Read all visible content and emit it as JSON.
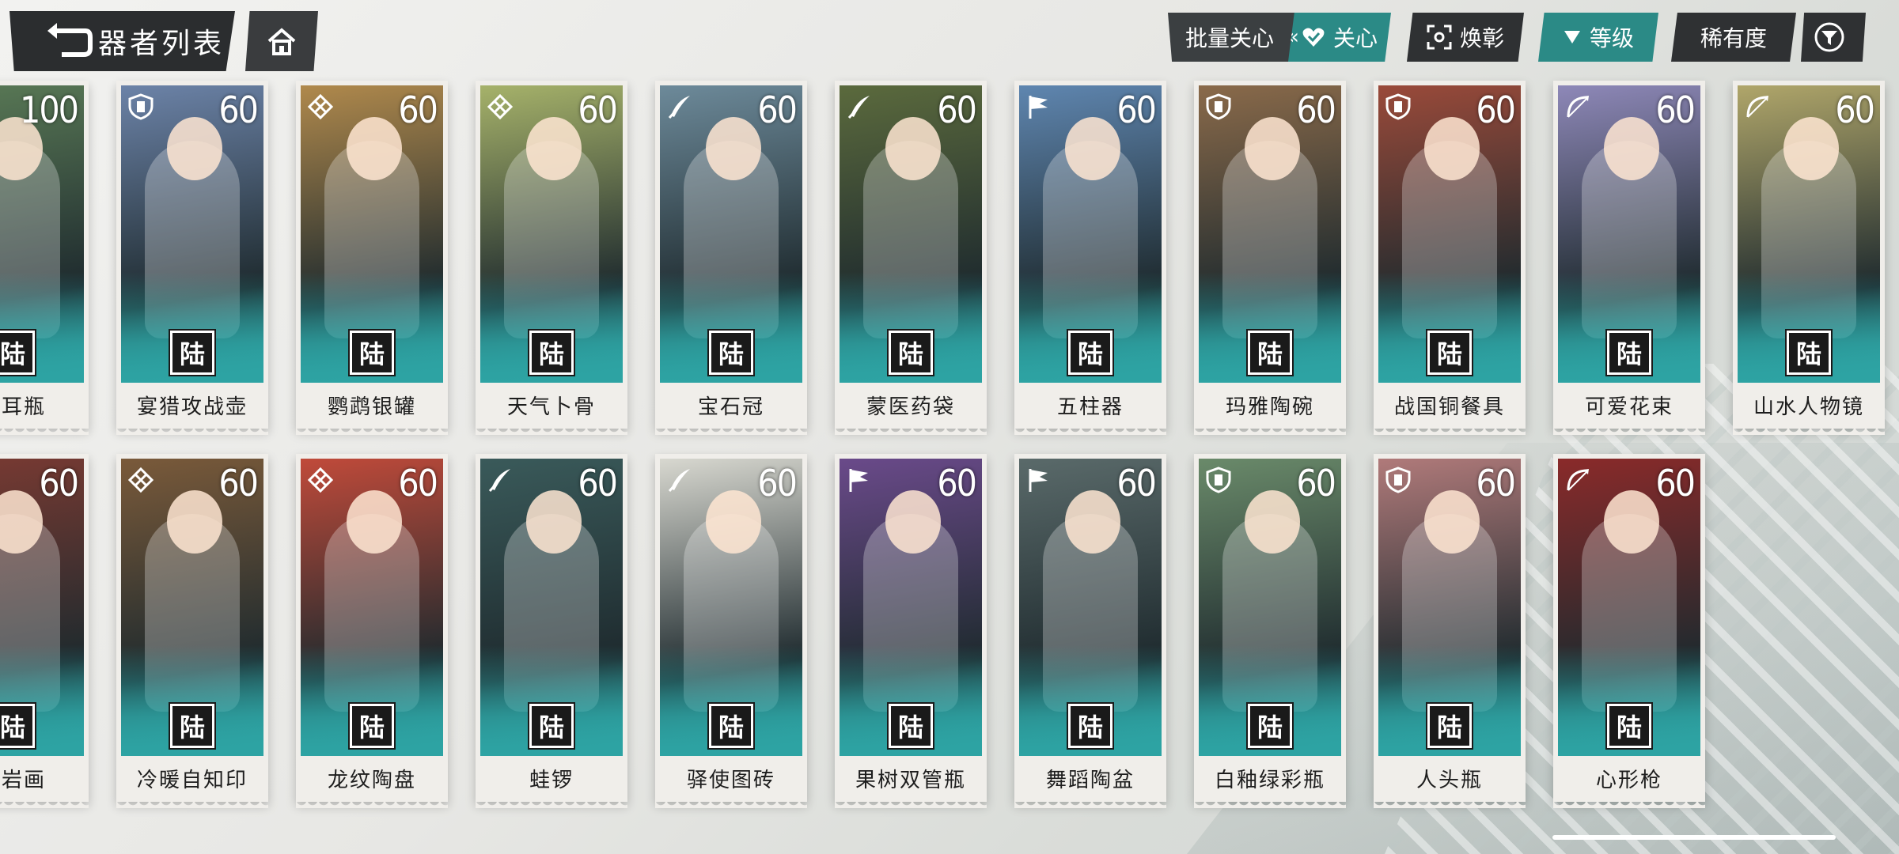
{
  "header": {
    "back_label": "器者列表",
    "batch_care": "批量关心",
    "care": "关心",
    "huanzhang": "焕彰",
    "level": "等级",
    "rarity": "稀有度"
  },
  "colors": {
    "teal": "#2b8a86",
    "dark": "#2f3133",
    "card_bg": "#f0eeea"
  },
  "cards": [
    {
      "name": "双耳瓶",
      "level": "100",
      "stamp": "陆",
      "class_icon": "bow-icon",
      "tint": "#5a7a56"
    },
    {
      "name": "宴猎攻战壶",
      "level": "60",
      "stamp": "陆",
      "class_icon": "shield-icon",
      "tint": "#6c83a8"
    },
    {
      "name": "鹦鹉银罐",
      "level": "60",
      "stamp": "陆",
      "class_icon": "knot-icon",
      "tint": "#b0894c"
    },
    {
      "name": "天气卜骨",
      "level": "60",
      "stamp": "陆",
      "class_icon": "knot-icon",
      "tint": "#a6b26a"
    },
    {
      "name": "宝石冠",
      "level": "60",
      "stamp": "陆",
      "class_icon": "quill-icon",
      "tint": "#6d8a9a"
    },
    {
      "name": "蒙医药袋",
      "level": "60",
      "stamp": "陆",
      "class_icon": "quill-icon",
      "tint": "#5b6a3d"
    },
    {
      "name": "五柱器",
      "level": "60",
      "stamp": "陆",
      "class_icon": "flag-icon",
      "tint": "#5f86b0"
    },
    {
      "name": "玛雅陶碗",
      "level": "60",
      "stamp": "陆",
      "class_icon": "shield-icon",
      "tint": "#8a6a4a"
    },
    {
      "name": "战国铜餐具",
      "level": "60",
      "stamp": "陆",
      "class_icon": "shield-icon",
      "tint": "#9a4a3a"
    },
    {
      "name": "可爱花束",
      "level": "60",
      "stamp": "陆",
      "class_icon": "bow-icon",
      "tint": "#8e88b8"
    },
    {
      "name": "山水人物镜",
      "level": "60",
      "stamp": "陆",
      "class_icon": "bow-icon",
      "tint": "#b0a66a"
    },
    {
      "name": "山岩画",
      "level": "60",
      "stamp": "陆",
      "class_icon": "shield-icon",
      "tint": "#7a3a32"
    },
    {
      "name": "冷暖自知印",
      "level": "60",
      "stamp": "陆",
      "class_icon": "knot-icon",
      "tint": "#7a5a3a"
    },
    {
      "name": "龙纹陶盘",
      "level": "60",
      "stamp": "陆",
      "class_icon": "knot-icon",
      "tint": "#c04a3a"
    },
    {
      "name": "蛙锣",
      "level": "60",
      "stamp": "陆",
      "class_icon": "quill-icon",
      "tint": "#3a5a5a"
    },
    {
      "name": "驿使图砖",
      "level": "60",
      "stamp": "陆",
      "class_icon": "quill-icon",
      "tint": "#d8d8d0"
    },
    {
      "name": "果树双管瓶",
      "level": "60",
      "stamp": "陆",
      "class_icon": "flag-icon",
      "tint": "#6a4a8a"
    },
    {
      "name": "舞蹈陶盆",
      "level": "60",
      "stamp": "陆",
      "class_icon": "flag-icon",
      "tint": "#5a6a6a"
    },
    {
      "name": "白釉绿彩瓶",
      "level": "60",
      "stamp": "陆",
      "class_icon": "shield-icon",
      "tint": "#6a8a6a"
    },
    {
      "name": "人头瓶",
      "level": "60",
      "stamp": "陆",
      "class_icon": "shield-icon",
      "tint": "#b07a7a"
    },
    {
      "name": "心形枪",
      "level": "60",
      "stamp": "陆",
      "class_icon": "bow-icon",
      "tint": "#8a2a2a"
    }
  ]
}
